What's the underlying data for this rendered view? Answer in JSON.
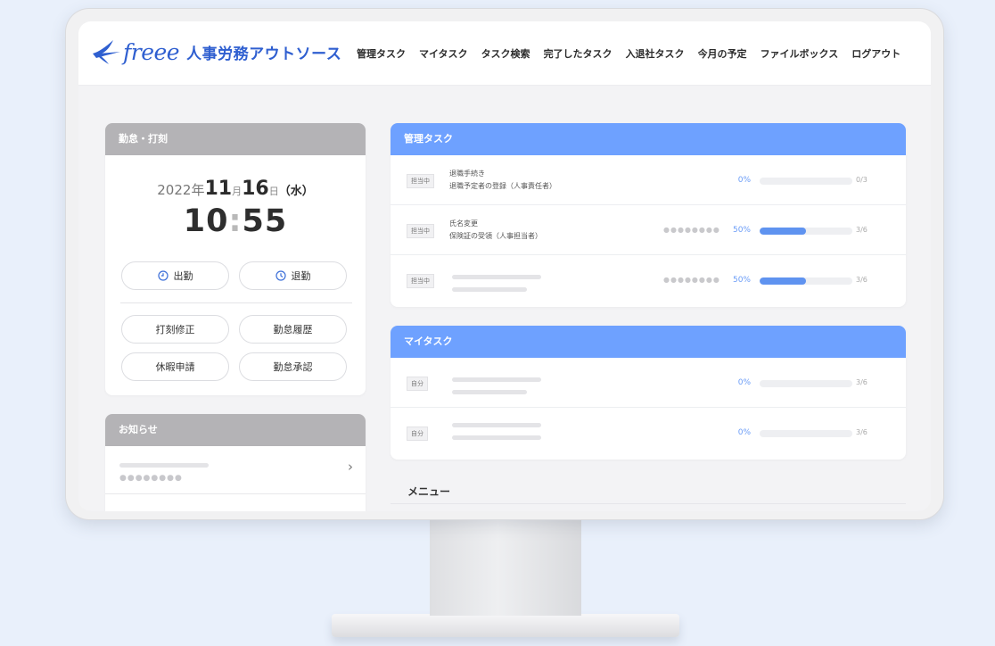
{
  "brand": {
    "word": "freee",
    "product": "人事労務アウトソース"
  },
  "nav": [
    "管理タスク",
    "マイタスク",
    "タスク検索",
    "完了したタスク",
    "入退社タスク",
    "今月の予定",
    "ファイルボックス",
    "ログアウト"
  ],
  "attendance": {
    "title": "勤怠・打刻",
    "date": {
      "year": "2022",
      "year_unit": "年",
      "month": "11",
      "month_unit": "月",
      "day": "16",
      "day_unit": "日",
      "weekday": "（水）"
    },
    "time": {
      "hours": "10",
      "sep": ":",
      "minutes": "55"
    },
    "clock_in": "出勤",
    "clock_out": "退勤",
    "actions": [
      "打刻修正",
      "勤怠履歴",
      "休暇申請",
      "勤怠承認"
    ]
  },
  "notices": {
    "title": "お知らせ",
    "dots": "●●●●●●●●"
  },
  "managed_tasks": {
    "title": "管理タスク",
    "rows": [
      {
        "tag": "担当中",
        "line1": "退職手続き",
        "line2": "退職予定者の登録（人事責任者）",
        "dots": "",
        "percent": "0%",
        "progress": 0,
        "count": "0/3"
      },
      {
        "tag": "担当中",
        "line1": "氏名変更",
        "line2": "保険証の受領（人事担当者）",
        "dots": "●●●●●●●●",
        "percent": "50%",
        "progress": 50,
        "count": "3/6"
      },
      {
        "tag": "担当中",
        "line1": "",
        "line2": "",
        "dots": "●●●●●●●●",
        "percent": "50%",
        "progress": 50,
        "count": "3/6"
      }
    ]
  },
  "my_tasks": {
    "title": "マイタスク",
    "rows": [
      {
        "tag": "自分",
        "percent": "0%",
        "progress": 0,
        "count": "3/6"
      },
      {
        "tag": "自分",
        "percent": "0%",
        "progress": 0,
        "count": "3/6"
      }
    ]
  },
  "menu": {
    "title": "メニュー"
  },
  "colors": {
    "brand": "#2f5fd0",
    "card_header_blue": "#6ea1ff",
    "card_header_gray": "#b4b3b6",
    "progress": "#5f93f0"
  }
}
